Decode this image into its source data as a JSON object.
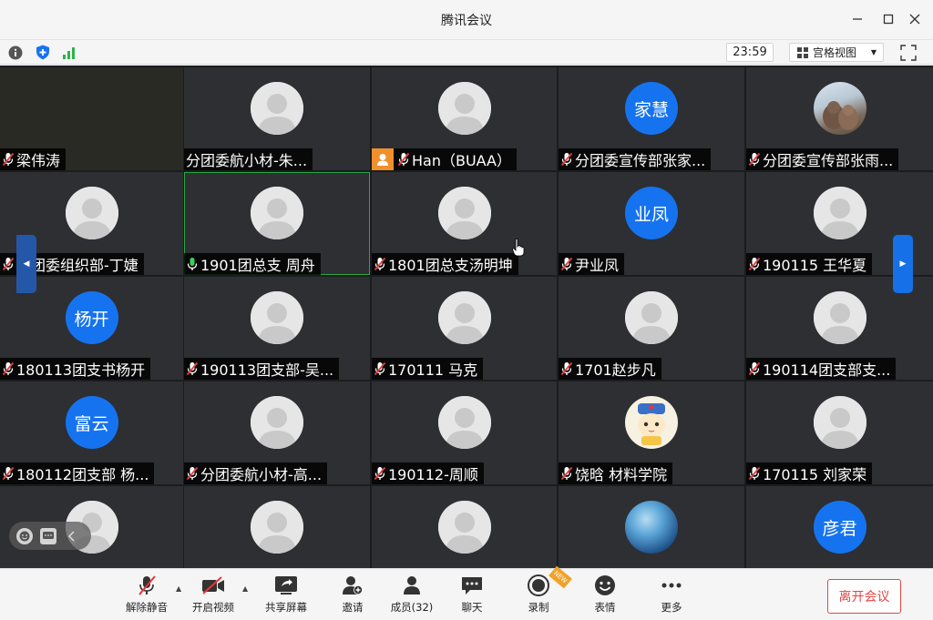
{
  "window": {
    "title": "腾讯会议"
  },
  "toolbar": {
    "timer": "23:59",
    "view_mode": "宫格视图"
  },
  "participants": [
    {
      "name": "梁伟涛",
      "avatar": "none",
      "mic": "muted"
    },
    {
      "name": "分团委航小材-朱...",
      "avatar": "default",
      "mic": "none"
    },
    {
      "name": "Han（BUAA）",
      "avatar": "default",
      "mic": "muted",
      "host": true
    },
    {
      "name": "分团委宣传部张家...",
      "avatar": "text",
      "avatar_text": "家慧",
      "mic": "muted"
    },
    {
      "name": "分团委宣传部张雨...",
      "avatar": "photo-otters",
      "mic": "muted"
    },
    {
      "name": "分团委组织部-丁婕",
      "avatar": "default",
      "mic": "muted"
    },
    {
      "name": "1901团总支 周舟",
      "avatar": "default",
      "mic": "active",
      "speaking": true
    },
    {
      "name": "1801团总支汤明坤",
      "avatar": "default",
      "mic": "muted"
    },
    {
      "name": "尹业凤",
      "avatar": "text",
      "avatar_text": "业凤",
      "mic": "muted"
    },
    {
      "name": "190115 王华夏",
      "avatar": "default",
      "mic": "muted"
    },
    {
      "name": "180113团支书杨开",
      "avatar": "text",
      "avatar_text": "杨开",
      "mic": "muted"
    },
    {
      "name": "190113团支部-吴...",
      "avatar": "default",
      "mic": "muted"
    },
    {
      "name": "170111 马克",
      "avatar": "default",
      "mic": "muted"
    },
    {
      "name": "1701赵步凡",
      "avatar": "default",
      "mic": "muted"
    },
    {
      "name": "190114团支部支...",
      "avatar": "default",
      "mic": "muted"
    },
    {
      "name": "180112团支部 杨...",
      "avatar": "text",
      "avatar_text": "富云",
      "mic": "muted"
    },
    {
      "name": "分团委航小材-高...",
      "avatar": "default",
      "mic": "muted"
    },
    {
      "name": "190112-周顺",
      "avatar": "default",
      "mic": "muted"
    },
    {
      "name": "饶晗  材料学院",
      "avatar": "cartoon",
      "mic": "muted"
    },
    {
      "name": "170115 刘家荣",
      "avatar": "default",
      "mic": "muted"
    },
    {
      "name": "",
      "avatar": "default",
      "mic": "none"
    },
    {
      "name": "",
      "avatar": "default",
      "mic": "none"
    },
    {
      "name": "",
      "avatar": "default",
      "mic": "none"
    },
    {
      "name": "",
      "avatar": "photo-sky",
      "mic": "none"
    },
    {
      "name": "",
      "avatar": "text",
      "avatar_text": "彦君",
      "mic": "none"
    }
  ],
  "bottombar": {
    "unmute": "解除静音",
    "start_video": "开启视频",
    "share_screen": "共享屏幕",
    "invite": "邀请",
    "members": "成员(32)",
    "chat": "聊天",
    "record": "录制",
    "record_badge": "NEW",
    "reactions": "表情",
    "more": "更多",
    "leave": "离开会议"
  },
  "colors": {
    "accent": "#1673f0",
    "leave": "#e54545",
    "host": "#f0902c",
    "speaking": "#27a844"
  }
}
